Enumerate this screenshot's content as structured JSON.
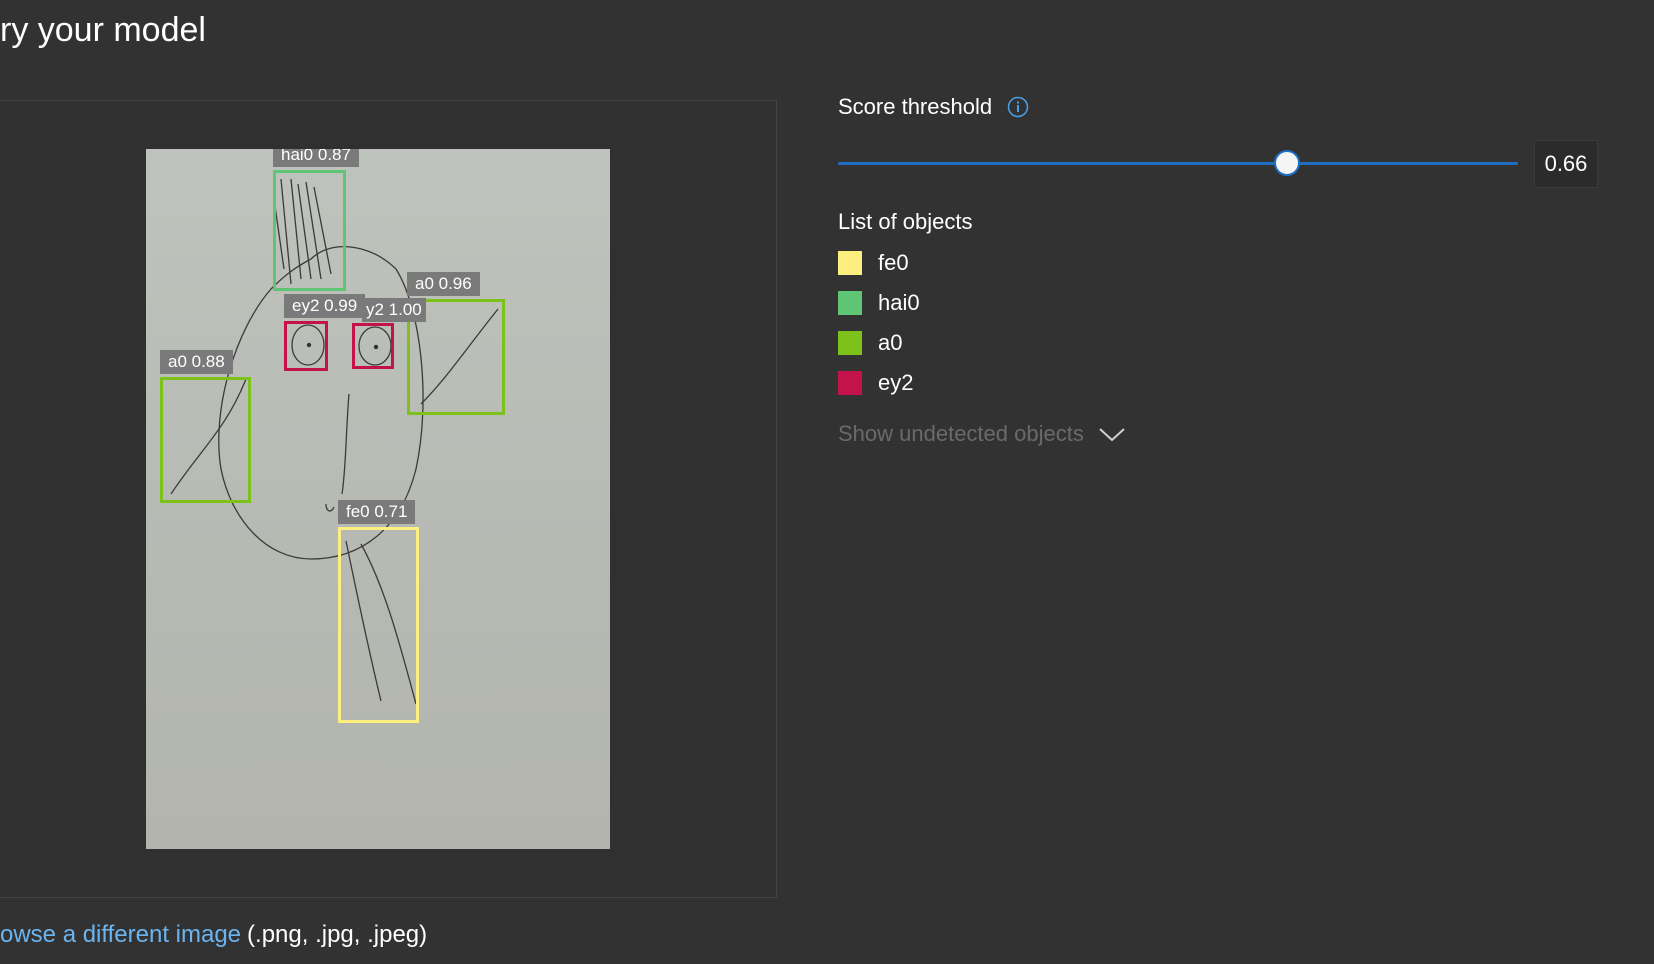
{
  "header": {
    "title": "ry your model"
  },
  "threshold": {
    "label": "Score threshold",
    "value": "0.66",
    "fraction": 0.66,
    "info_icon": "info-icon",
    "accent_color": "#1e6fc2"
  },
  "detections": [
    {
      "label": "hai0 0.87",
      "color": "#5fc474"
    },
    {
      "label": "a0 0.96",
      "color": "#7cc21a"
    },
    {
      "label": "ey2 0.99",
      "color": "#c4124a"
    },
    {
      "label": "y2 1.00",
      "color": "#c4124a"
    },
    {
      "label": "a0 0.88",
      "color": "#7cc21a"
    },
    {
      "label": "fe0 0.71",
      "color": "#fcef7f"
    }
  ],
  "objects": {
    "heading": "List of objects",
    "items": [
      {
        "name": "fe0",
        "color": "#fcef7f"
      },
      {
        "name": "hai0",
        "color": "#5fc474"
      },
      {
        "name": "a0",
        "color": "#7cc21a"
      },
      {
        "name": "ey2",
        "color": "#c4124a"
      }
    ],
    "undetected_label": "Show undetected objects",
    "undetected_icon": "chevron-down-icon"
  },
  "browse": {
    "link_text": "owse a different image",
    "formats": "(.png, .jpg, .jpeg)"
  }
}
